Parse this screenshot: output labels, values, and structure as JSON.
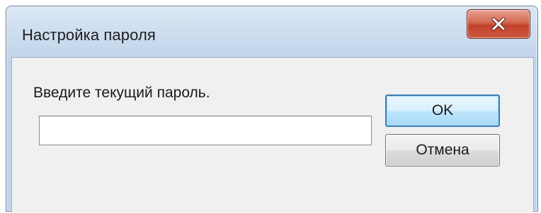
{
  "window": {
    "title": "Настройка пароля"
  },
  "dialog": {
    "prompt": "Введите текущий пароль.",
    "password_value": "",
    "ok_label": "OK",
    "cancel_label": "Отмена"
  },
  "icons": {
    "close": "close-icon"
  },
  "colors": {
    "titlebar": "#c6d8ec",
    "close_button": "#c1412a",
    "client_area": "#f0f0f0",
    "default_button_border": "#3c7fb1"
  }
}
